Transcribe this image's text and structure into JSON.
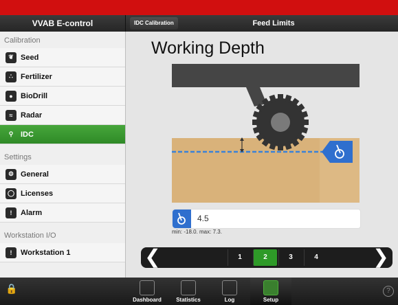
{
  "app": {
    "title": "VVAB E-control"
  },
  "header": {
    "tab_label": "IDC Calibration",
    "title": "Feed Limits"
  },
  "sidebar": {
    "sections": [
      {
        "title": "Calibration",
        "items": [
          {
            "label": "Seed",
            "icon": "seed-icon"
          },
          {
            "label": "Fertilizer",
            "icon": "fertilizer-icon"
          },
          {
            "label": "BioDrill",
            "icon": "biodrill-icon"
          },
          {
            "label": "Radar",
            "icon": "radar-icon"
          },
          {
            "label": "IDC",
            "icon": "idc-icon",
            "active": true
          }
        ]
      },
      {
        "title": "Settings",
        "items": [
          {
            "label": "General",
            "icon": "general-icon"
          },
          {
            "label": "Licenses",
            "icon": "licenses-icon"
          },
          {
            "label": "Alarm",
            "icon": "alarm-icon"
          }
        ]
      },
      {
        "title": "Workstation I/O",
        "items": [
          {
            "label": "Workstation 1",
            "icon": "workstation-icon"
          }
        ]
      }
    ]
  },
  "main": {
    "title": "Working Depth",
    "value": "4.5",
    "range": "min: -18.0. max: 7.3."
  },
  "pager": {
    "pages": [
      "1",
      "2",
      "3",
      "4"
    ],
    "active": "2",
    "prev": "❮",
    "next": "❯"
  },
  "bottom_tabs": [
    {
      "label": "Dashboard",
      "icon": "dashboard-icon"
    },
    {
      "label": "Statistics",
      "icon": "statistics-icon"
    },
    {
      "label": "Log",
      "icon": "log-icon"
    },
    {
      "label": "Setup",
      "icon": "setup-icon",
      "active": true
    }
  ],
  "colors": {
    "accent_green": "#3a9a30",
    "brand_red": "#d10f0f",
    "idc_blue": "#2f6fce",
    "soil": "#d9b27a"
  },
  "icons": {
    "help": "?"
  }
}
